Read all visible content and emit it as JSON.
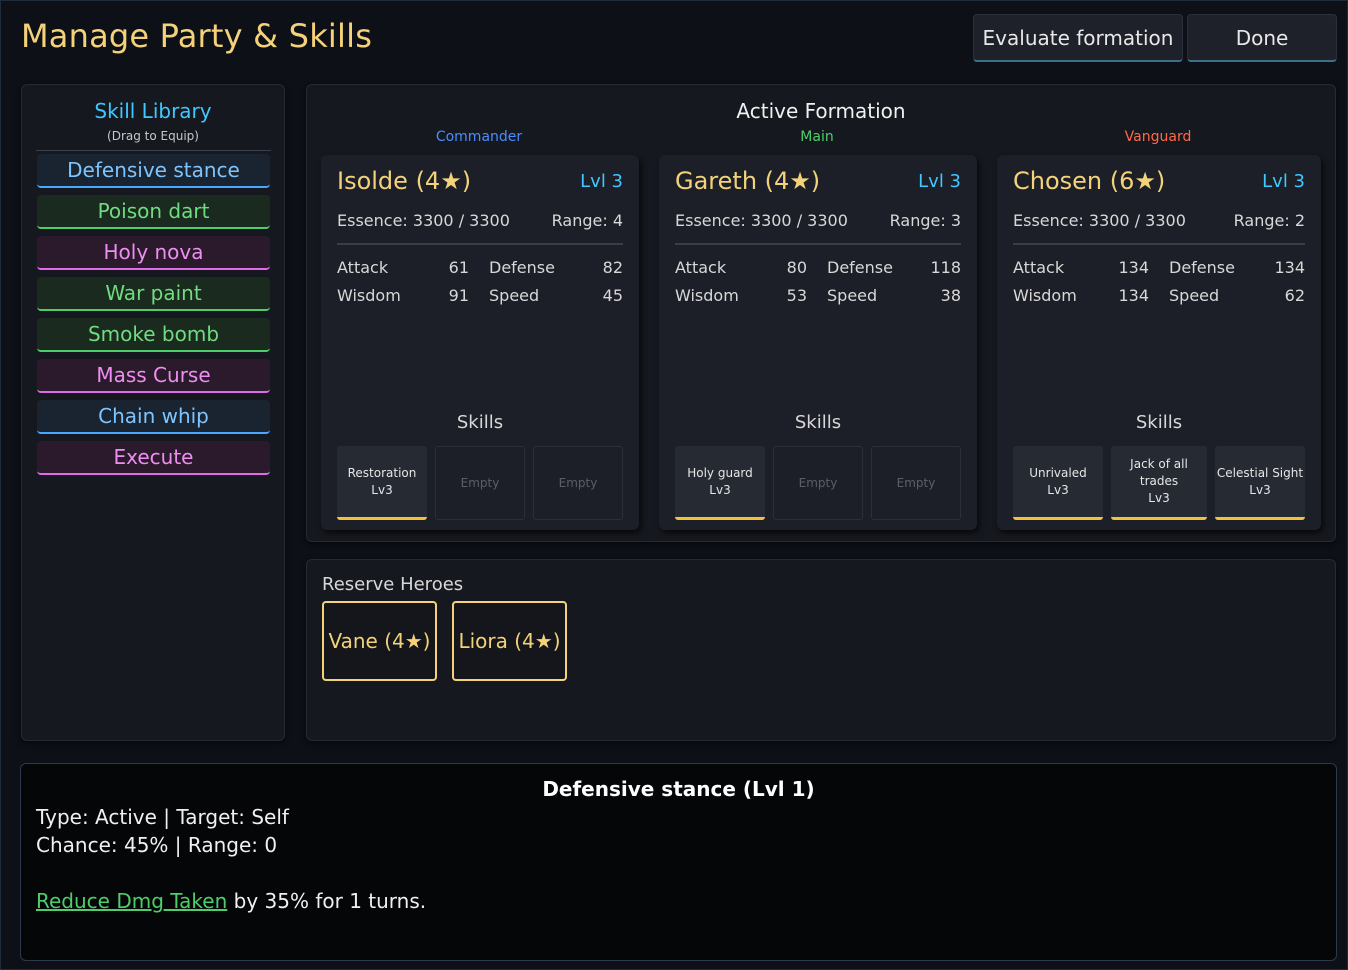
{
  "header": {
    "title": "Manage Party & Skills",
    "evaluate_label": "Evaluate formation",
    "done_label": "Done"
  },
  "library": {
    "title": "Skill Library",
    "subtitle": "(Drag to Equip)",
    "items": [
      {
        "label": "Defensive stance",
        "color": "#4aa7ff"
      },
      {
        "label": "Poison dart",
        "color": "#4ccf6a"
      },
      {
        "label": "Holy nova",
        "color": "#e06ae8"
      },
      {
        "label": "War paint",
        "color": "#4ccf6a"
      },
      {
        "label": "Smoke bomb",
        "color": "#4ccf6a"
      },
      {
        "label": "Mass Curse",
        "color": "#e06ae8"
      },
      {
        "label": "Chain whip",
        "color": "#4aa7ff"
      },
      {
        "label": "Execute",
        "color": "#e06ae8"
      }
    ]
  },
  "formation": {
    "title": "Active Formation",
    "skills_label": "Skills",
    "heroes": [
      {
        "role": "Commander",
        "role_color": "#4a8cff",
        "name": "Isolde (4★)",
        "level": "Lvl 3",
        "essence": "Essence: 3300 / 3300",
        "range": "Range: 4",
        "stats": {
          "attack_label": "Attack",
          "attack": "61",
          "defense_label": "Defense",
          "defense": "82",
          "wisdom_label": "Wisdom",
          "wisdom": "91",
          "speed_label": "Speed",
          "speed": "45"
        },
        "skills": [
          {
            "name": "Restoration",
            "level": "Lv3"
          },
          {
            "name": "Empty",
            "level": ""
          },
          {
            "name": "Empty",
            "level": ""
          }
        ]
      },
      {
        "role": "Main",
        "role_color": "#4ccf6a",
        "name": "Gareth (4★)",
        "level": "Lvl 3",
        "essence": "Essence: 3300 / 3300",
        "range": "Range: 3",
        "stats": {
          "attack_label": "Attack",
          "attack": "80",
          "defense_label": "Defense",
          "defense": "118",
          "wisdom_label": "Wisdom",
          "wisdom": "53",
          "speed_label": "Speed",
          "speed": "38"
        },
        "skills": [
          {
            "name": "Holy guard",
            "level": "Lv3"
          },
          {
            "name": "Empty",
            "level": ""
          },
          {
            "name": "Empty",
            "level": ""
          }
        ]
      },
      {
        "role": "Vanguard",
        "role_color": "#ff6a4a",
        "name": "Chosen (6★)",
        "level": "Lvl 3",
        "essence": "Essence: 3300 / 3300",
        "range": "Range: 2",
        "stats": {
          "attack_label": "Attack",
          "attack": "134",
          "defense_label": "Defense",
          "defense": "134",
          "wisdom_label": "Wisdom",
          "wisdom": "134",
          "speed_label": "Speed",
          "speed": "62"
        },
        "skills": [
          {
            "name": "Unrivaled",
            "level": "Lv3"
          },
          {
            "name": "Jack of all trades",
            "level": "Lv3"
          },
          {
            "name": "Celestial Sight",
            "level": "Lv3"
          }
        ]
      }
    ]
  },
  "reserve": {
    "title": "Reserve Heroes",
    "heroes": [
      "Vane (4★)",
      "Liora (4★)"
    ]
  },
  "detail": {
    "title": "Defensive stance (Lvl 1)",
    "line1": "Type: Active | Target: Self",
    "line2": "Chance: 45% | Range: 0",
    "effect_key": "Reduce Dmg Taken",
    "effect_rest": " by 35% for 1 turns."
  }
}
